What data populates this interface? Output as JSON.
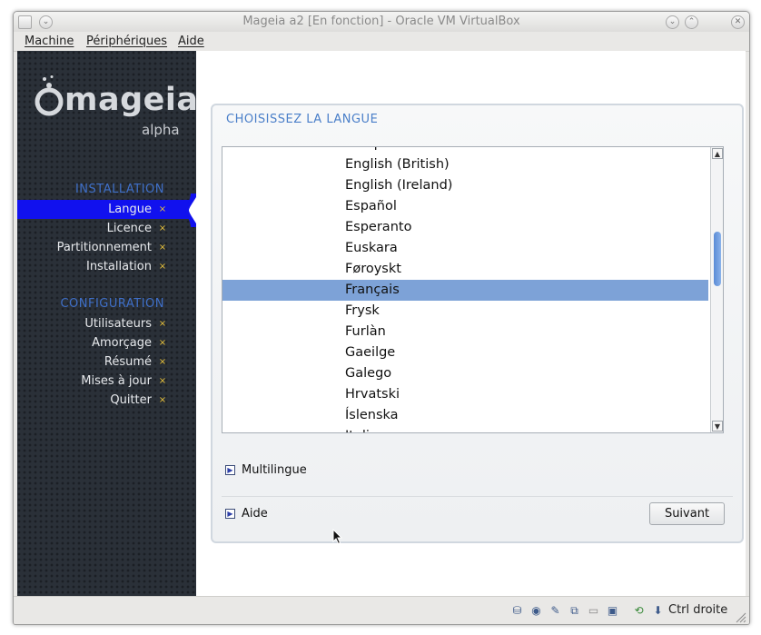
{
  "window": {
    "title": "Mageia a2 [En fonction] - Oracle VM VirtualBox",
    "controls": [
      "minimize-icon",
      "maximize-icon",
      "close-icon"
    ]
  },
  "menubar": {
    "items": [
      {
        "label": "Machine"
      },
      {
        "label": "Périphériques"
      },
      {
        "label": "Aide"
      }
    ]
  },
  "sidebar": {
    "logo_text": "mageia",
    "logo_sub": "alpha",
    "sections": [
      {
        "heading": "INSTALLATION",
        "steps": [
          {
            "label": "Langue",
            "active": true
          },
          {
            "label": "Licence"
          },
          {
            "label": "Partitionnement"
          },
          {
            "label": "Installation"
          }
        ]
      },
      {
        "heading": "CONFIGURATION",
        "steps": [
          {
            "label": "Utilisateurs"
          },
          {
            "label": "Amorçage"
          },
          {
            "label": "Résumé"
          },
          {
            "label": "Mises à jour"
          },
          {
            "label": "Quitter"
          }
        ]
      }
    ],
    "step_marker": "×",
    "accent_color": "#1111ee"
  },
  "panel": {
    "title": "CHOISISSEZ LA LANGUE",
    "languages": [
      "Ελληνικά",
      "English (British)",
      "English (Ireland)",
      "Español",
      "Esperanto",
      "Euskara",
      "Føroyskt",
      "Français",
      "Frysk",
      "Furlàn",
      "Gaeilge",
      "Galego",
      "Hrvatski",
      "Íslenska",
      "Italiano"
    ],
    "selected_language": "Français",
    "selection_color": "#7da2d7",
    "multilingual_label": "Multilingue",
    "help_label": "Aide",
    "next_label": "Suivant"
  },
  "statusbar": {
    "icons": [
      "hard-disk-icon",
      "optical-disk-icon",
      "usb-icon",
      "network-icon",
      "shared-folder-icon",
      "display-icon",
      "virtualization-icon",
      "mouse-integration-icon"
    ],
    "host_key": "Ctrl droite"
  }
}
